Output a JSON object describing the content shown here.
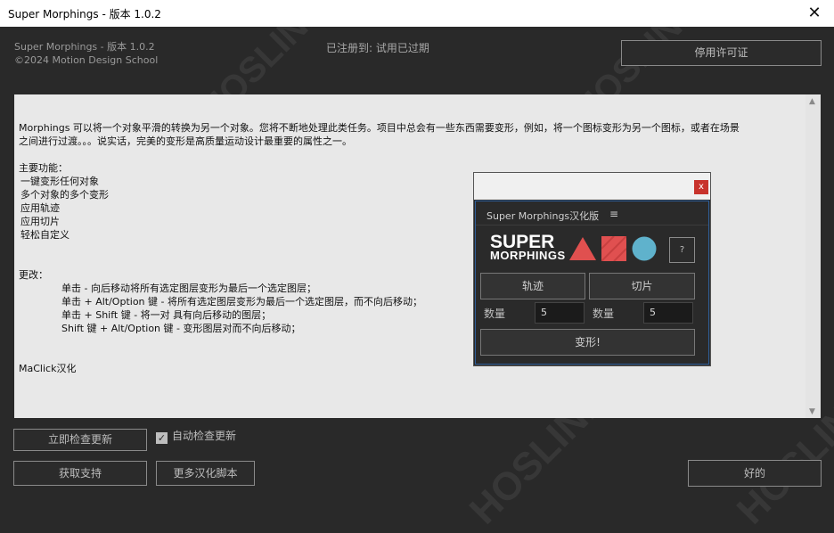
{
  "window": {
    "title": "Super Morphings - 版本 1.0.2",
    "close_glyph": "✕"
  },
  "header": {
    "app_version": "Super Morphings - 版本 1.0.2",
    "copyright": "©2024 Motion Design School",
    "registration": "已注册到:  试用已过期",
    "license_button": "停用许可证"
  },
  "content": {
    "intro_line1": "Morphings 可以将一个对象平滑的转换为另一个对象。您将不断地处理此类任务。项目中总会有一些东西需要变形，例如，将一个图标变形为另一个图标，或者在场景",
    "intro_line2": "之间进行过渡。。。说实话，完美的变形是高质量运动设计最重要的属性之一。",
    "features_title": "主要功能：",
    "features": [
      "一键变形任何对象",
      "多个对象的多个变形",
      "应用轨迹",
      "应用切片",
      "轻松自定义"
    ],
    "changes_title": "更改：",
    "changes": [
      "单击 - 向后移动将所有选定图层变形为最后一个选定图层；",
      "单击 + Alt/Option 键 - 将所有选定图层变形为最后一个选定图层，而不向后移动；",
      "单击 + Shift 键 - 将一对 具有向后移动的图层；",
      "Shift 键 + Alt/Option 键 - 变形图层对而不向后移动；"
    ],
    "credit": "MaClick汉化"
  },
  "panel": {
    "close_glyph": "x",
    "title": "Super  Morphings汉化版",
    "menu_glyph": "≡",
    "logo_line1": "SUPER",
    "logo_line2": "MORPHINGS",
    "help_label": "?",
    "trail_button": "轨迹",
    "slice_button": "切片",
    "count_label_1": "数量",
    "count_value_1": "5",
    "count_label_2": "数量",
    "count_value_2": "5",
    "morph_button": "变形!",
    "colors": {
      "triangle": "#e0504f",
      "square": "#e05050",
      "circle": "#5fb2cc"
    }
  },
  "footer": {
    "check_update_button": "立即检查更新",
    "auto_update_label": "自动检查更新",
    "auto_update_checked": true,
    "support_button": "获取支持",
    "more_scripts_button": "更多汉化脚本",
    "ok_button": "好的"
  },
  "scroll": {
    "up_glyph": "▲",
    "down_glyph": "▼"
  }
}
